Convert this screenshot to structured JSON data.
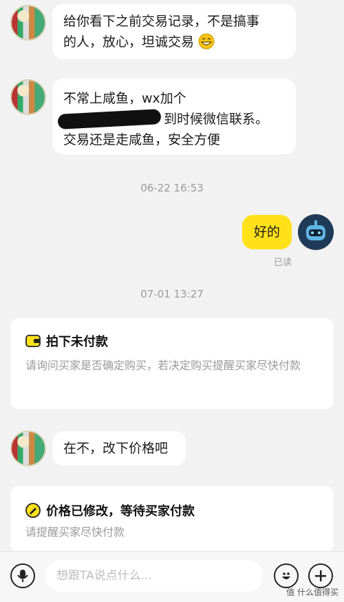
{
  "messages": [
    {
      "text_lines": [
        "给你看下之前交易记录，不是搞事",
        "的人，放心，坦诚交易"
      ]
    },
    {
      "line1": "不常上咸鱼，wx加个",
      "line2": "到时候微信联系。",
      "line3": "交易还是走咸鱼，安全方便"
    },
    {
      "text": "在不，改下价格吧"
    }
  ],
  "timestamps": [
    "06-22 16:53",
    "07-01 13:27"
  ],
  "my_reply": {
    "text": "好的",
    "status": "已读"
  },
  "cards": [
    {
      "title": "拍下未付款",
      "desc": "请询问买家是否确定购买，若决定购买提醒买家尽快付款",
      "icon": "wallet-icon"
    },
    {
      "title": "价格已修改，等待买家付款",
      "desc": "请提醒买家尽快付款",
      "icon": "edit-icon"
    }
  ],
  "input": {
    "placeholder": "想跟TA说点什么..."
  },
  "watermark": "值 什么值得买",
  "colors": {
    "accent": "#ffe11a",
    "background": "#f2f2f2"
  }
}
